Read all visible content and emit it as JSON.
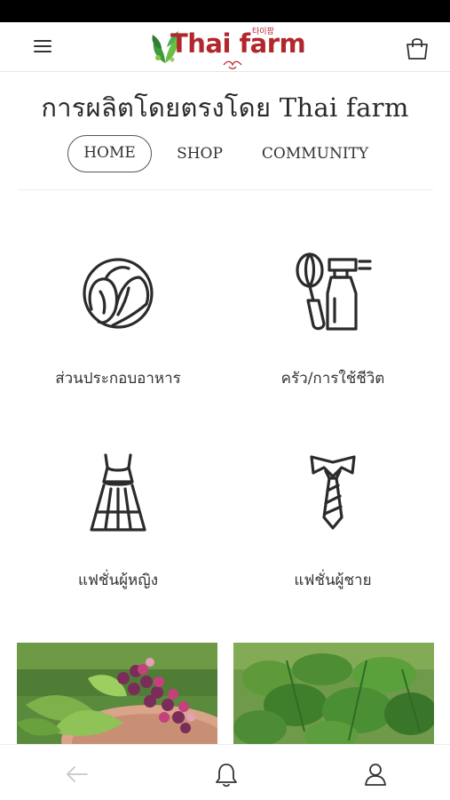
{
  "app": {
    "logo_text": "Thai farm",
    "logo_korean": "타이팜"
  },
  "header": {
    "menu_icon": "hamburger-menu-icon",
    "cart_icon": "shopping-bag-icon"
  },
  "page": {
    "title": "การผลิตโดยตรงโดย Thai farm"
  },
  "tabs": [
    {
      "label": "HOME",
      "selected": true
    },
    {
      "label": "SHOP",
      "selected": false
    },
    {
      "label": "COMMUNITY",
      "selected": false
    }
  ],
  "categories": [
    {
      "label": "ส่วนประกอบอาหาร",
      "icon": "cabbage-icon"
    },
    {
      "label": "ครัว/การใช้ชีวิต",
      "icon": "whisk-spray-bottle-icon"
    },
    {
      "label": "แฟชั่นผู้หญิง",
      "icon": "dress-icon"
    },
    {
      "label": "แฟชั่นผู้ชาย",
      "icon": "necktie-icon"
    }
  ],
  "bottom_nav": {
    "back_icon": "back-arrow-icon",
    "notifications_icon": "bell-icon",
    "profile_icon": "user-icon"
  },
  "colors": {
    "brand_red": "#b2262d",
    "logo_green": "#3f9a3a",
    "icon_stroke": "#2b2b2b",
    "tab_border": "#555555"
  }
}
